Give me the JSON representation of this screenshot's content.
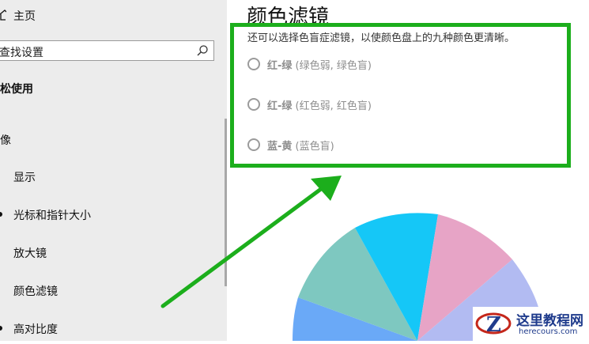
{
  "sidebar": {
    "home_label": "主页",
    "search_placeholder": "查找设置",
    "section_title": "松使用",
    "group_label": "像",
    "items": [
      {
        "label": "显示"
      },
      {
        "label": "光标和指针大小"
      },
      {
        "label": "放大镜"
      },
      {
        "label": "颜色滤镜"
      },
      {
        "label": "高对比度"
      }
    ]
  },
  "main": {
    "title": "颜色滤镜",
    "description": "还可以选择色盲症滤镜，以使颜色盘上的九种颜色更清晰。",
    "options": [
      {
        "name": "红-绿",
        "detail": " (绿色弱, 绿色盲)",
        "selected": false
      },
      {
        "name": "红-绿",
        "detail": " (红色弱, 红色盲)",
        "selected": false
      },
      {
        "name": "蓝-黄",
        "detail": " (蓝色盲)",
        "selected": false
      }
    ]
  },
  "wheel": {
    "colors": [
      "#6aa9f7",
      "#7ec8c0",
      "#15c7f7",
      "#e7a4c6",
      "#b2bbf2"
    ]
  },
  "annotation": {
    "color": "#1cae1c"
  },
  "watermark": {
    "title": "这里教程网",
    "url": "herecours.com"
  }
}
